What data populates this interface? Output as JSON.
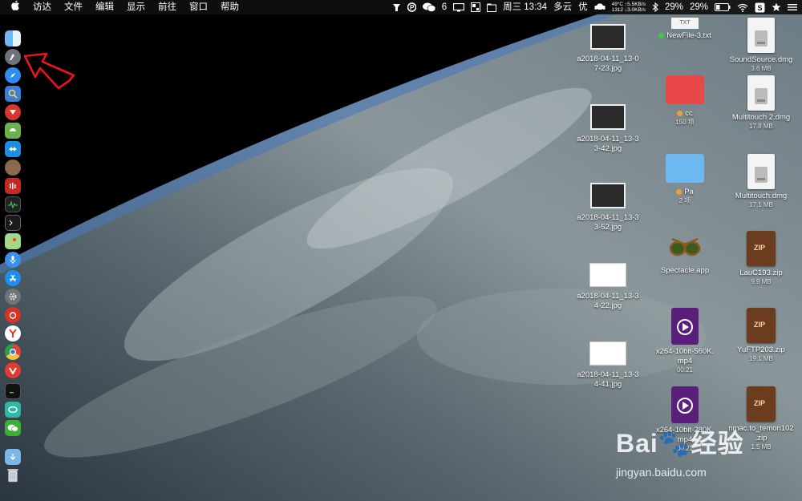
{
  "menubar": {
    "menus": [
      "访达",
      "文件",
      "编辑",
      "显示",
      "前往",
      "窗口",
      "帮助"
    ],
    "status": {
      "notification_count": "6",
      "temperature": "49°C",
      "net_up": "↑5.5KB/s",
      "cpu_freq": "1312",
      "net_down": "↓3.0KB/s",
      "clock": "周三 13:34",
      "weather": "多云",
      "weather_quality": "优",
      "cpu_percent": "29%",
      "battery_percent": "29%"
    }
  },
  "dock": {
    "items": [
      "finder",
      "launchpad",
      "safari",
      "preview",
      "mail-app",
      "android-studio",
      "teamviewer",
      "coin",
      "music-app",
      "activity-monitor",
      "terminal",
      "maps",
      "siri",
      "app-store",
      "system-preferences",
      "netease-music",
      "yandex",
      "chrome",
      "vivaldi",
      "terminal-2",
      "sync",
      "wechat",
      "downloads",
      "trash"
    ]
  },
  "desktop": {
    "icons": [
      {
        "id": "shot1",
        "label": "a2018-04-11_13-0",
        "label2": "7-23.jpg"
      },
      {
        "id": "shot2",
        "label": "a2018-04-11_13-3",
        "label2": "3-42.jpg"
      },
      {
        "id": "shot3",
        "label": "a2018-04-11_13-3",
        "label2": "3-52.jpg"
      },
      {
        "id": "shot4",
        "label": "a2018-04-11_13-3",
        "label2": "4-22.jpg"
      },
      {
        "id": "shot5",
        "label": "a2018-04-11_13-3",
        "label2": "4-41.jpg"
      },
      {
        "id": "txt",
        "badge": "TXT",
        "label": "NewFile-3.txt"
      },
      {
        "id": "cc",
        "label": "cc",
        "sub": "150 项"
      },
      {
        "id": "pa",
        "label": "Pa",
        "sub": "2 项"
      },
      {
        "id": "spectacle",
        "label": "Spectacle.app"
      },
      {
        "id": "mp4a",
        "label": "x264-10bit-560K.",
        "label2": "mp4",
        "sub": "00:21"
      },
      {
        "id": "mp4b",
        "label": "x264-10bit-280K.",
        "label2": "mp4",
        "sub": "00:21"
      },
      {
        "id": "sound",
        "label": "SoundSource.dmg",
        "sub": "3.6 MB"
      },
      {
        "id": "mt2",
        "label": "Multitouch 2.dmg",
        "sub": "17.8 MB"
      },
      {
        "id": "mt",
        "label": "Multitouch.dmg",
        "sub": "17.1 MB"
      },
      {
        "id": "lauc",
        "badge": "ZIP",
        "label": "LauC193.zip",
        "sub": "9.9 MB"
      },
      {
        "id": "yuftp",
        "badge": "ZIP",
        "label": "YuFTP203.zip",
        "sub": "19.1 MB"
      },
      {
        "id": "nmac",
        "badge": "ZIP",
        "label": "nmac.to_temon102",
        "label2": ".zip",
        "sub": "1.5 MB"
      }
    ]
  },
  "watermark": {
    "brand": "Bai",
    "brand_cn": "经验",
    "url": "jingyan.baidu.com"
  },
  "colors": {
    "menubar": "#0f0f0f",
    "arrow": "#e8141e",
    "folder_red": "#e84848",
    "folder_blue": "#6db8f0"
  }
}
